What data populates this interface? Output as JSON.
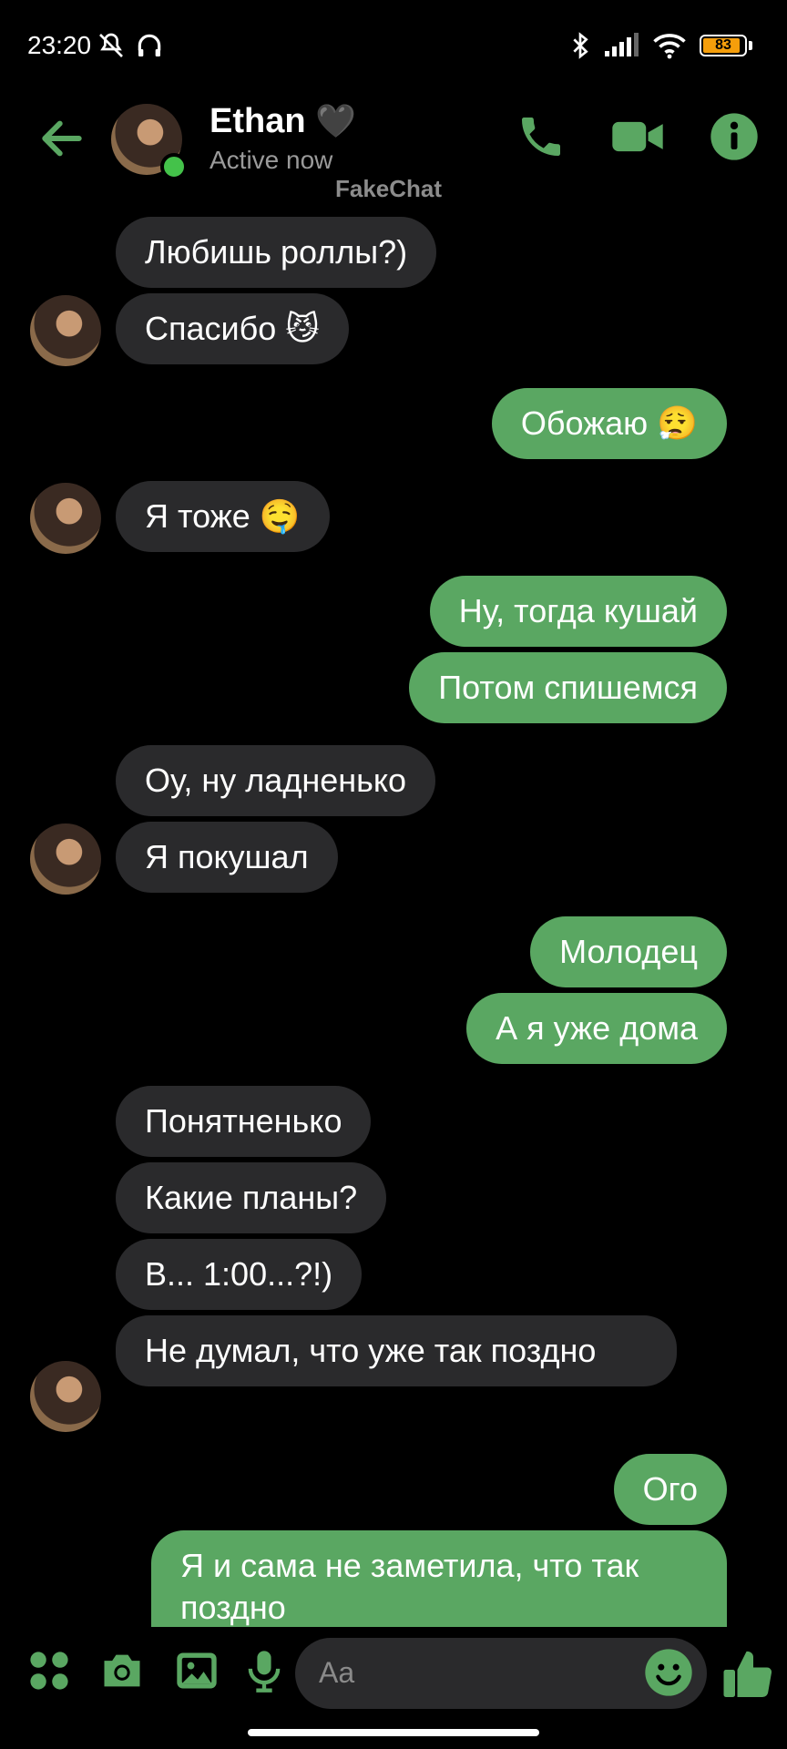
{
  "status_bar": {
    "time": "23:20",
    "battery": "83"
  },
  "header": {
    "contact_name": "Ethan",
    "name_emoji": "🖤",
    "status": "Active now",
    "watermark": "FakeChat"
  },
  "messages": [
    {
      "side": "in",
      "text": "Любишь роллы?)"
    },
    {
      "side": "in",
      "text": "Спасибо 😼"
    },
    {
      "side": "out",
      "text": "Обожаю 😮‍💨"
    },
    {
      "side": "in",
      "text": "Я тоже 🤤"
    },
    {
      "side": "out",
      "text": "Ну, тогда кушай"
    },
    {
      "side": "out",
      "text": "Потом спишемся"
    },
    {
      "side": "in",
      "text": "Оу, ну ладненько"
    },
    {
      "side": "in",
      "text": "Я покушал"
    },
    {
      "side": "out",
      "text": "Молодец"
    },
    {
      "side": "out",
      "text": "А я уже дома"
    },
    {
      "side": "in",
      "text": "Понятненько"
    },
    {
      "side": "in",
      "text": "Какие планы?"
    },
    {
      "side": "in",
      "text": "В... 1:00...?!)"
    },
    {
      "side": "in",
      "text": "Не думал, что уже так поздно"
    },
    {
      "side": "out",
      "text": "Ого"
    },
    {
      "side": "out",
      "text": "Я и сама не заметила, что так поздно"
    }
  ],
  "composer": {
    "placeholder": "Aa"
  },
  "colors": {
    "accent": "#5aa762",
    "incoming_bubble": "#2a2a2c",
    "background": "#000000"
  },
  "icons": [
    "back-arrow-icon",
    "phone-icon",
    "video-icon",
    "info-icon",
    "apps-icon",
    "camera-icon",
    "gallery-icon",
    "mic-icon",
    "emoji-icon",
    "thumbs-up-icon"
  ]
}
